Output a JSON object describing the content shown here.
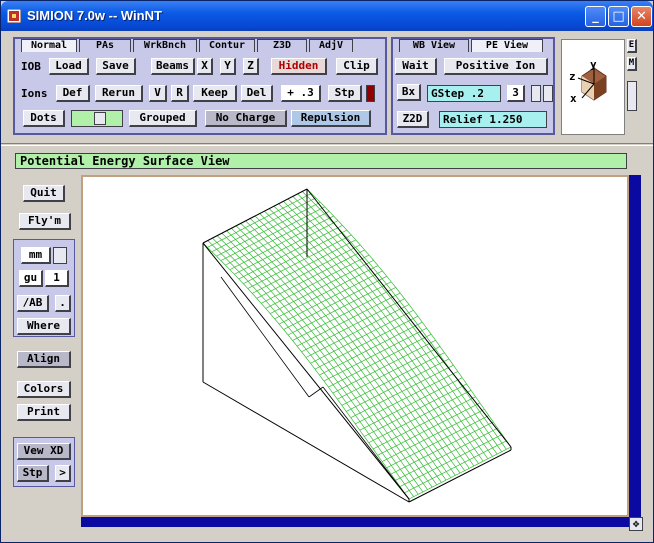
{
  "window": {
    "title": "SIMION 7.0w -- WinNT"
  },
  "tabs_left": [
    {
      "label": "Normal",
      "active": true
    },
    {
      "label": "PAs",
      "active": false
    },
    {
      "label": "WrkBnch",
      "active": false
    },
    {
      "label": "Contur",
      "active": false
    },
    {
      "label": "Z3D",
      "active": false
    },
    {
      "label": "AdjV",
      "active": false
    }
  ],
  "tabs_right": [
    {
      "label": "WB View",
      "active": false
    },
    {
      "label": "PE View",
      "active": true
    }
  ],
  "iob_row": {
    "label": "IOB",
    "load": "Load",
    "save": "Save",
    "beams": "Beams",
    "x": "X",
    "y": "Y",
    "z": "Z",
    "hidden": "Hidden",
    "clip": "Clip"
  },
  "ions_row": {
    "label": "Ions",
    "def": "Def",
    "rerun": "Rerun",
    "v": "V",
    "r": "R",
    "keep": "Keep",
    "del": "Del",
    "value": "+ .3",
    "stp": "Stp"
  },
  "dots_row": {
    "dots": "Dots",
    "grouped": "Grouped",
    "no_charge": "No Charge",
    "repulsion": "Repulsion"
  },
  "pe_controls": {
    "wait": "Wait",
    "positive_ion": "Positive Ion",
    "bx": "Bx",
    "gstep": "GStep .2",
    "gstep_count": "3",
    "z2d": "Z2D",
    "relief": "Relief 1.250"
  },
  "right_strip": {
    "top": "E",
    "mid": "M"
  },
  "axis_gizmo": {
    "x": "x",
    "y": "y",
    "z": "z"
  },
  "view_title": "Potential Energy Surface View",
  "sidebar": {
    "quit": "Quit",
    "flym": "Fly'm",
    "units": "mm",
    "gu": "gu",
    "gu_value": "1",
    "ab": "/AB",
    "dot": ".",
    "where": "Where",
    "align": "Align",
    "colors": "Colors",
    "print": "Print",
    "view_xd": "Vew XD",
    "stp": "Stp",
    "arrow": ">"
  },
  "colors": {
    "accent": "#5858a0",
    "mesh": "#33bb33",
    "title_bar": "#0b5ae5",
    "header": "#b0f0a8",
    "field": "#a8f0f0",
    "scroll": "#0a0aa0"
  }
}
